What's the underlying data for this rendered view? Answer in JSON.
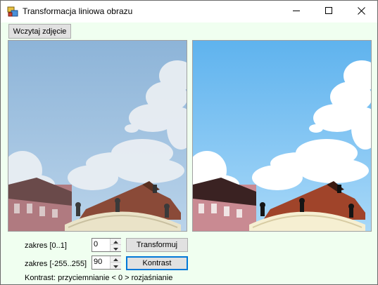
{
  "window": {
    "title": "Transformacja liniowa obrazu"
  },
  "toolbar": {
    "load_label": "Wczytaj zdjęcie"
  },
  "controls": {
    "range1_label": "zakres [0..1]",
    "range1_value": "0",
    "range2_label": "zakres [-255..255]",
    "range2_value": "90",
    "transform_label": "Transformuj",
    "contrast_label": "Kontrast",
    "info_text": "Kontrast: przyciemnianie < 0 > rozjaśnianie"
  },
  "icons": {
    "app": "app-icon",
    "minimize": "minimize-icon",
    "maximize": "maximize-icon",
    "close": "close-icon",
    "spin_up": "chevron-up-icon",
    "spin_down": "chevron-down-icon"
  },
  "colors": {
    "client_background": "#f0fff0",
    "focus_border": "#0078d7",
    "button_face": "#e1e1e1"
  }
}
